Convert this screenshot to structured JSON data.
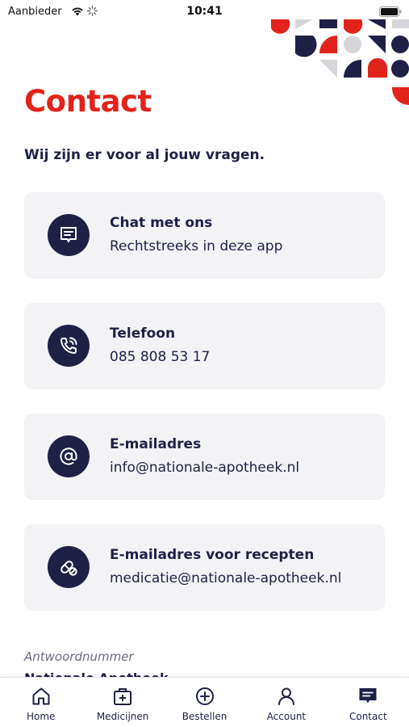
{
  "status_bar": {
    "carrier": "Aanbieder",
    "time": "10:41"
  },
  "colors": {
    "brand_red": "#e2231a",
    "navy": "#1e2046",
    "card_bg": "#f3f3f6",
    "pattern_grey": "#d6d6da"
  },
  "page": {
    "title": "Contact",
    "subtitle": "Wij zijn er voor al jouw vragen."
  },
  "contact_cards": [
    {
      "icon": "chat-icon",
      "title": "Chat met ons",
      "text": "Rechtstreeks in deze app"
    },
    {
      "icon": "phone-icon",
      "title": "Telefoon",
      "text": "085 808 53 17"
    },
    {
      "icon": "at-sign-icon",
      "title": "E-mailadres",
      "text": "info@nationale-apotheek.nl"
    },
    {
      "icon": "pill-icon",
      "title": "E-mailadres voor recepten",
      "text": "medicatie@nationale-apotheek.nl"
    }
  ],
  "antwoordnummer": {
    "label": "Antwoordnummer",
    "value": "Nationale Apotheek"
  },
  "tab_bar": {
    "active": "Contact",
    "tabs": [
      {
        "label": "Home",
        "icon": "home-icon"
      },
      {
        "label": "Medicijnen",
        "icon": "medicine-box-icon"
      },
      {
        "label": "Bestellen",
        "icon": "plus-circle-icon"
      },
      {
        "label": "Account",
        "icon": "user-icon"
      },
      {
        "label": "Contact",
        "icon": "chat-icon"
      }
    ]
  }
}
